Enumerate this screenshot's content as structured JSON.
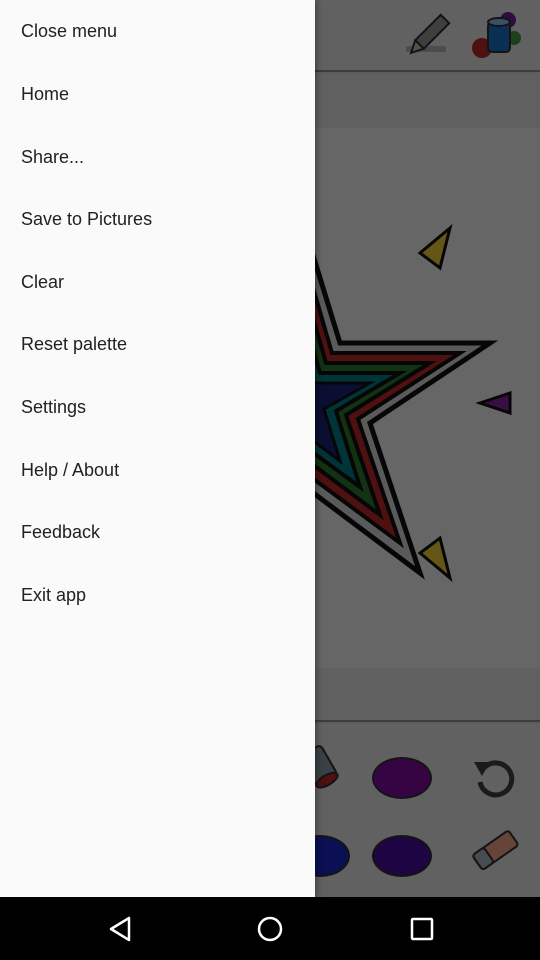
{
  "menu": {
    "items": [
      {
        "label": "Close menu"
      },
      {
        "label": "Home"
      },
      {
        "label": "Share..."
      },
      {
        "label": "Save to Pictures"
      },
      {
        "label": "Clear"
      },
      {
        "label": "Reset palette"
      },
      {
        "label": "Settings"
      },
      {
        "label": "Help / About"
      },
      {
        "label": "Feedback"
      },
      {
        "label": "Exit app"
      }
    ]
  },
  "toolbar": {
    "icons": [
      "pencil-icon",
      "paint-bucket-icon"
    ]
  },
  "palette": {
    "colors": {
      "swatch_top": "#8a0aa8",
      "swatch_bottom": "#4a0aa8",
      "swatch_partial": "#1a2ad0"
    },
    "icons": [
      "paint-pot-icon",
      "undo-icon",
      "eraser-icon"
    ]
  },
  "navbar": {
    "icons": [
      "back-icon",
      "home-icon",
      "recents-icon"
    ]
  },
  "colors": {
    "drawer_bg": "#fafafa",
    "text": "#212121",
    "scrim": "rgba(0,0,0,0.6)"
  }
}
